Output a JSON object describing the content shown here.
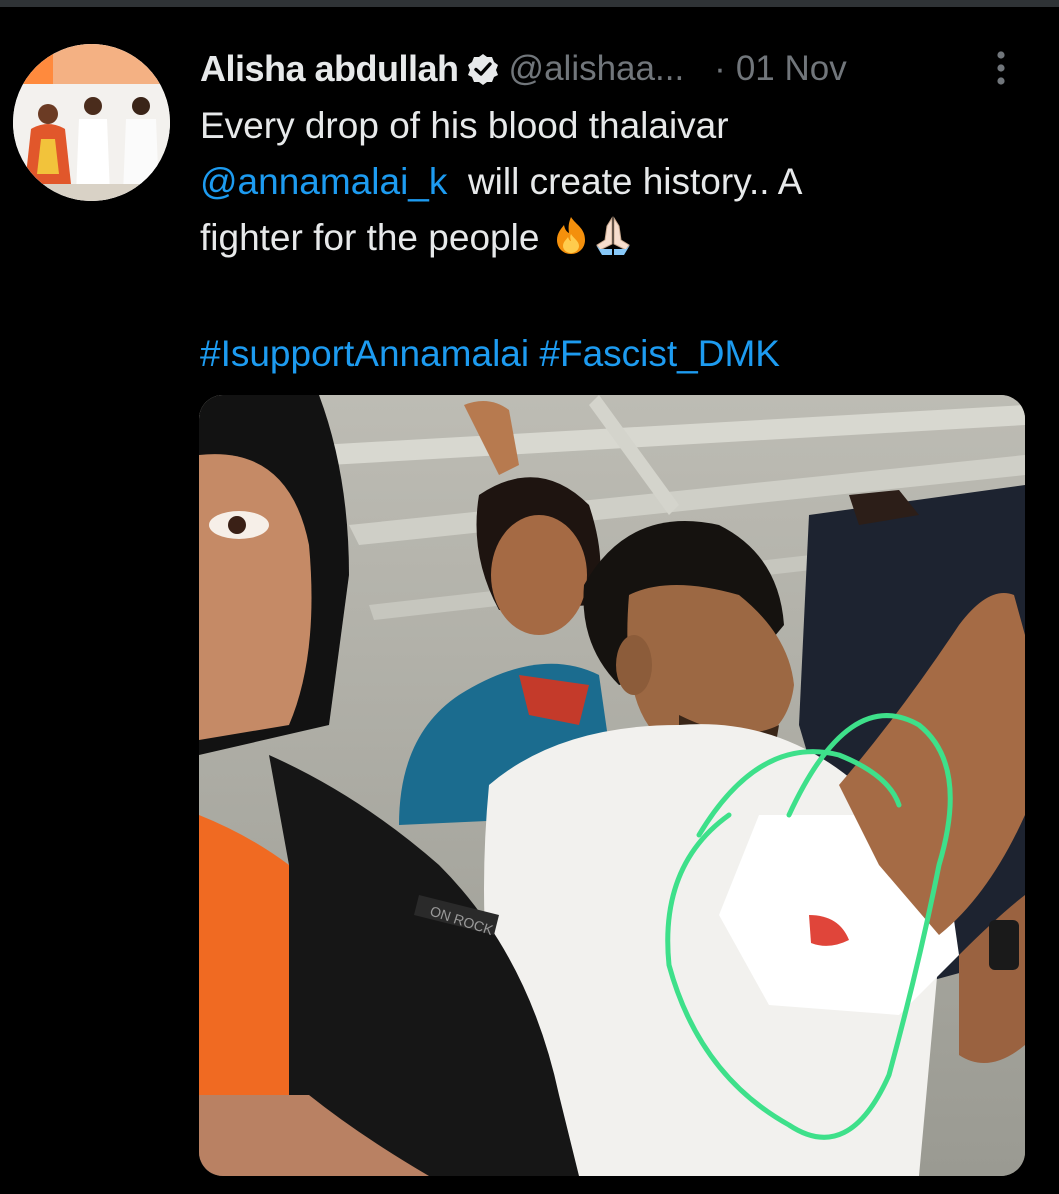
{
  "tweet": {
    "author": {
      "display_name": "Alisha abdullah",
      "handle": "@alishaa...",
      "verified": true
    },
    "separator": "·",
    "date": "01 Nov",
    "text": {
      "line1": "Every drop of his blood thalaivar",
      "mention": "@annamalai_k",
      "line2_rest": "will create history.. A",
      "line3": "fighter for the people"
    },
    "emojis": [
      "fire-emoji",
      "folded-hands-emoji"
    ],
    "hashtags": [
      "#IsupportAnnamalai",
      "#Fascist_DMK"
    ],
    "media": {
      "description_icon": "photo",
      "jacket_text": "ON ROCK"
    }
  },
  "icons": {
    "verified": "verified-badge-icon",
    "more": "more-vertical-icon"
  },
  "colors": {
    "background": "#000000",
    "text": "#e7e9ea",
    "secondary": "#71767b",
    "link": "#1d9bf0",
    "highlight_circle": "#3ee08a"
  }
}
